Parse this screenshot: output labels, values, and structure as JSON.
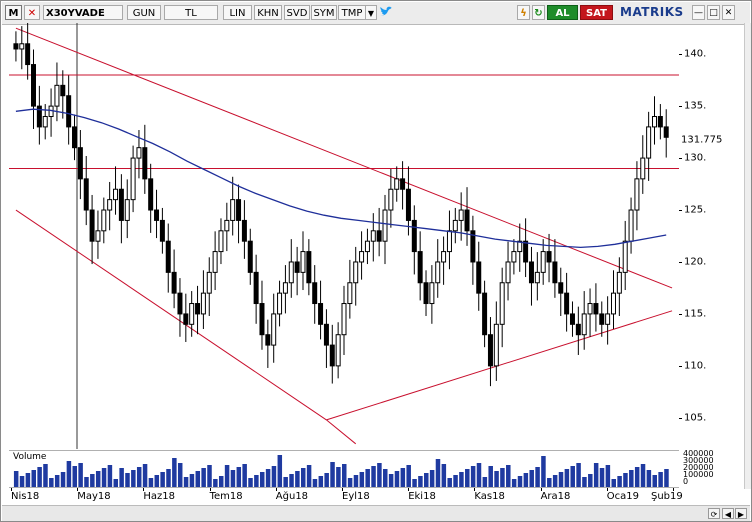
{
  "toolbar": {
    "m_label": "M",
    "symbol": "X30YVADE",
    "period": "GUN",
    "currency": "TL",
    "lin": "LIN",
    "khn": "KHN",
    "svd": "SVD",
    "sym": "SYM",
    "tmp": "TMP",
    "buy_label": "AL",
    "sell_label": "SAT",
    "logo": "MATRIKS",
    "buy_color": "#1e8c2a",
    "sell_color": "#c4161c",
    "icons": [
      "twitter-icon",
      "bolt-icon",
      "refresh-icon",
      "minimize-icon",
      "maximize-icon",
      "close-icon"
    ]
  },
  "volume": {
    "label": "Volume",
    "axis_labels": [
      "400000",
      "300000",
      "200000",
      "100000",
      "0"
    ]
  },
  "chart_data": {
    "type": "candlestick",
    "ylim": [
      102,
      143
    ],
    "yticks": [
      105,
      110,
      115,
      120,
      125,
      130,
      135,
      140
    ],
    "last_value": "131.775",
    "x_labels": [
      "Nis18",
      "May18",
      "Haz18",
      "Tem18",
      "Ağu18",
      "Eyl18",
      "Eki18",
      "Kas18",
      "Ara18",
      "Oca19",
      "Şub19"
    ],
    "horizontal_lines": [
      138,
      129
    ],
    "close_series": [
      140.5,
      141,
      139,
      135,
      133,
      134,
      135,
      137,
      136,
      133,
      131,
      128,
      125,
      122,
      123,
      125,
      126,
      127,
      124,
      126,
      130,
      131,
      128,
      125,
      124,
      122,
      119,
      117,
      115,
      114,
      116,
      115,
      117,
      119,
      121,
      123,
      124,
      126,
      124,
      122,
      119,
      116,
      113,
      112,
      115,
      117,
      118,
      120,
      119,
      121,
      118,
      116,
      114,
      112,
      110,
      113,
      116,
      118,
      120,
      121,
      122,
      123,
      122,
      125,
      127,
      128,
      127,
      124,
      121,
      118,
      116,
      118,
      120,
      121,
      123,
      124,
      125,
      123,
      120,
      117,
      113,
      110,
      114,
      118,
      120,
      121,
      122,
      120,
      118,
      119,
      121,
      120,
      118,
      117,
      115,
      114,
      113,
      115,
      116,
      115,
      114,
      115,
      117,
      119,
      122,
      125,
      128,
      130,
      133,
      134,
      133,
      132
    ],
    "ma_series": [
      134.5,
      134.7,
      134.6,
      134.3,
      133.9,
      133.4,
      132.8,
      132.1,
      131.4,
      130.6,
      129.7,
      128.9,
      128.1,
      127.3,
      126.6,
      126.0,
      125.4,
      124.9,
      124.5,
      124.2,
      124.0,
      123.8,
      123.6,
      123.4,
      123.2,
      123.0,
      122.8,
      122.5,
      122.2,
      122.0,
      121.8,
      121.6,
      121.5,
      121.4,
      121.5,
      121.7,
      122.0,
      122.3,
      122.6
    ],
    "trendlines": [
      {
        "from": [
          0,
          142.5
        ],
        "to": [
          112,
          117.5
        ]
      },
      {
        "from": [
          0,
          125
        ],
        "to": [
          53,
          104.8
        ]
      },
      {
        "from": [
          53,
          104.8
        ],
        "to": [
          112,
          115.3
        ]
      },
      {
        "from": [
          53,
          104.8
        ],
        "to": [
          58,
          102.5
        ]
      }
    ],
    "colors": {
      "up": "#ffffff",
      "down": "#000000",
      "outline": "#000000",
      "ma": "#1f2f9a",
      "trend": "#c8102e",
      "hline": "#c8102e",
      "volume": "#1f3aa0"
    }
  }
}
